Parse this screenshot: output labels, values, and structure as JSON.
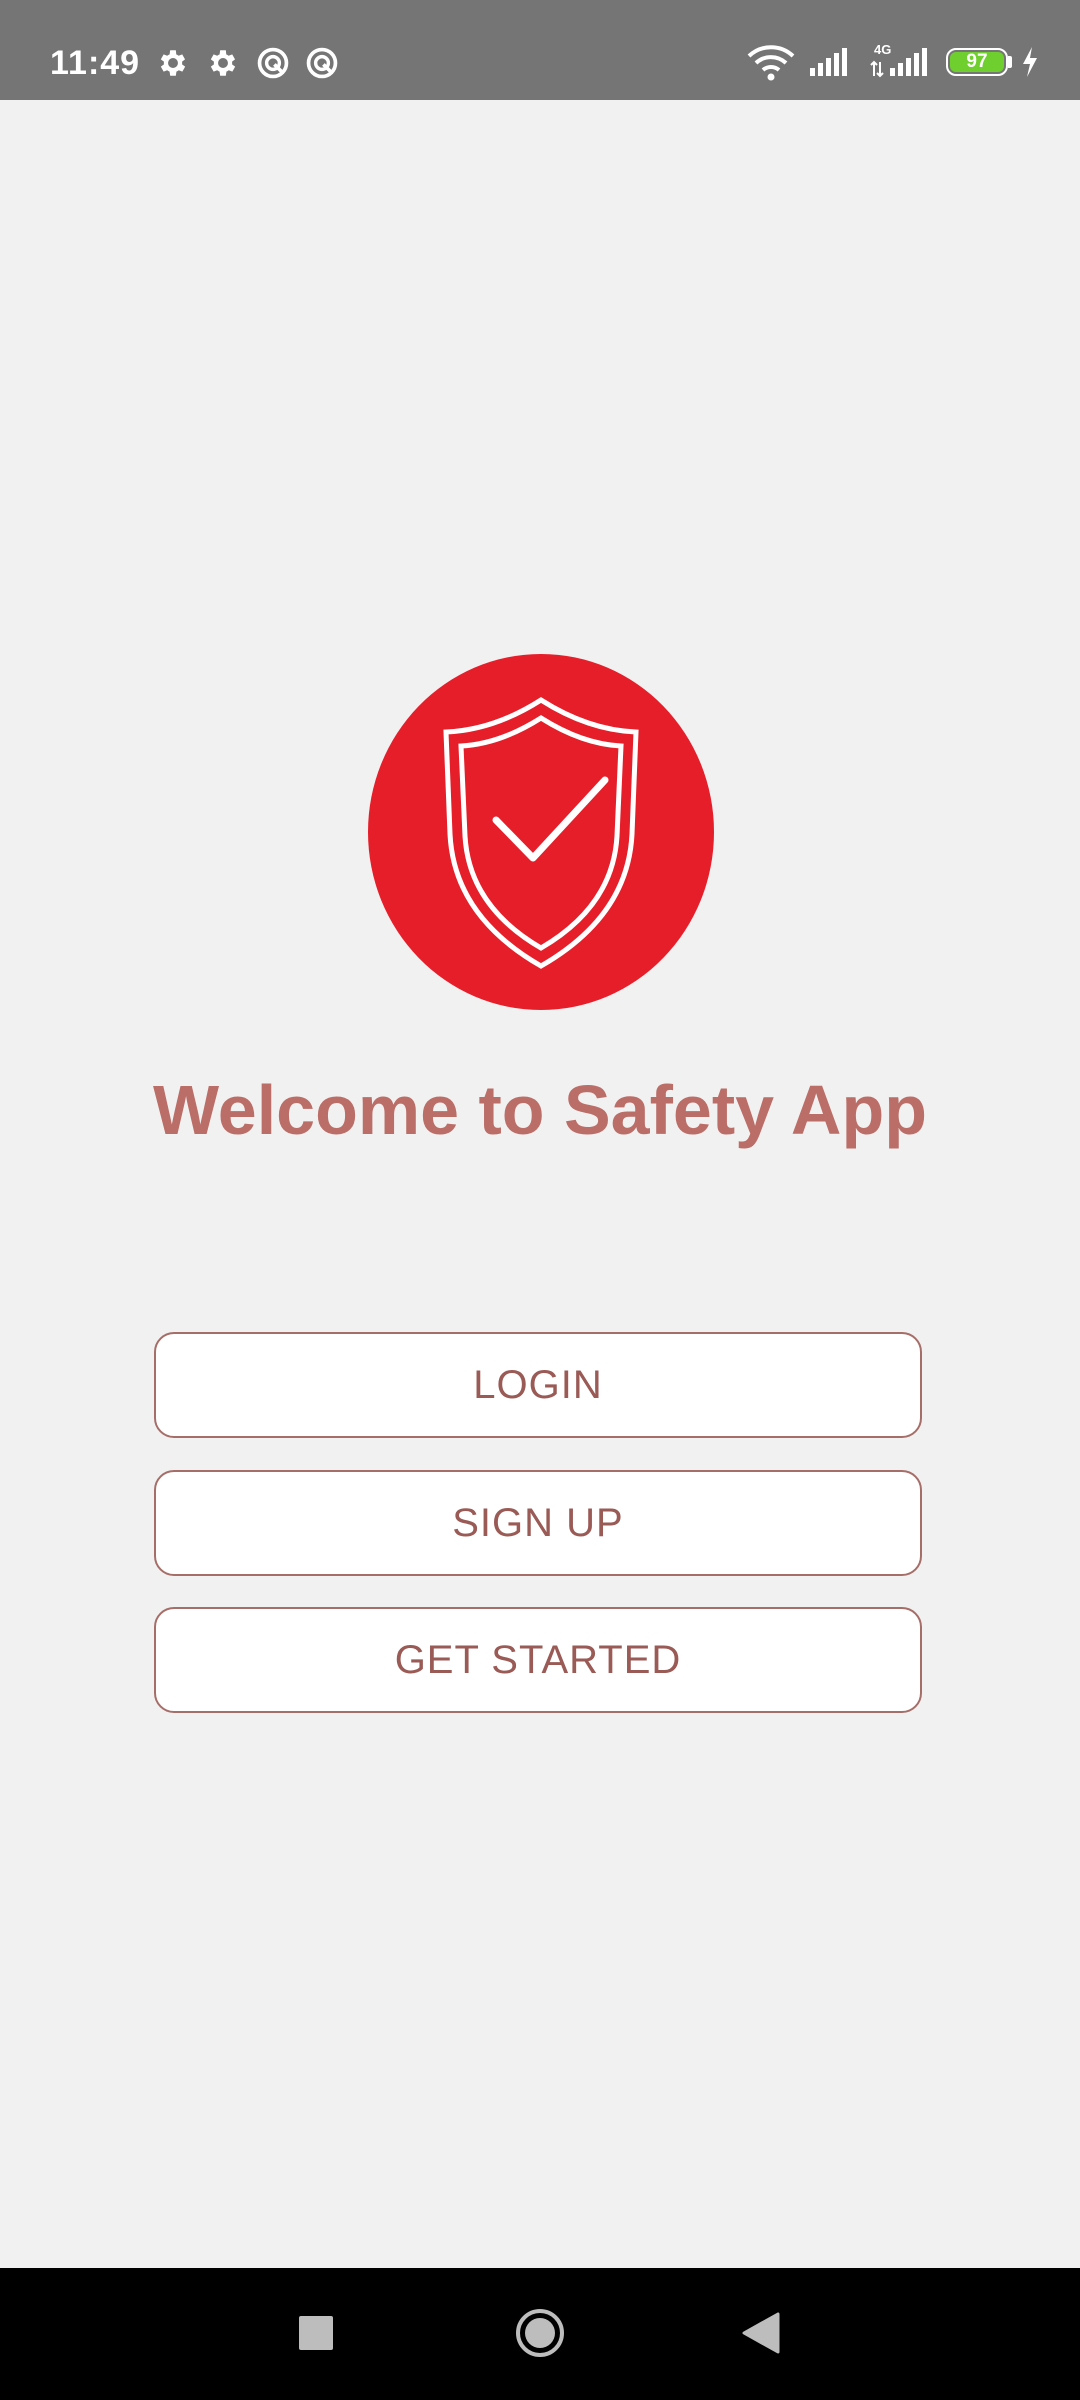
{
  "status_bar": {
    "time": "11:49",
    "left_icons": [
      "settings-icon",
      "settings-icon",
      "sync-icon",
      "sync-icon"
    ],
    "network_type": "4G",
    "battery_level": "97",
    "battery_color": "#6fcf2f",
    "charging": true
  },
  "main": {
    "logo_icon": "shield-check-icon",
    "logo_color": "#e51e2a",
    "welcome_title": "Welcome to Safety App",
    "buttons": {
      "login": "LOGIN",
      "signup": "SIGN UP",
      "get_started": "GET STARTED"
    }
  },
  "nav_bar": {
    "items": [
      "recents-icon",
      "home-icon",
      "back-icon"
    ]
  }
}
